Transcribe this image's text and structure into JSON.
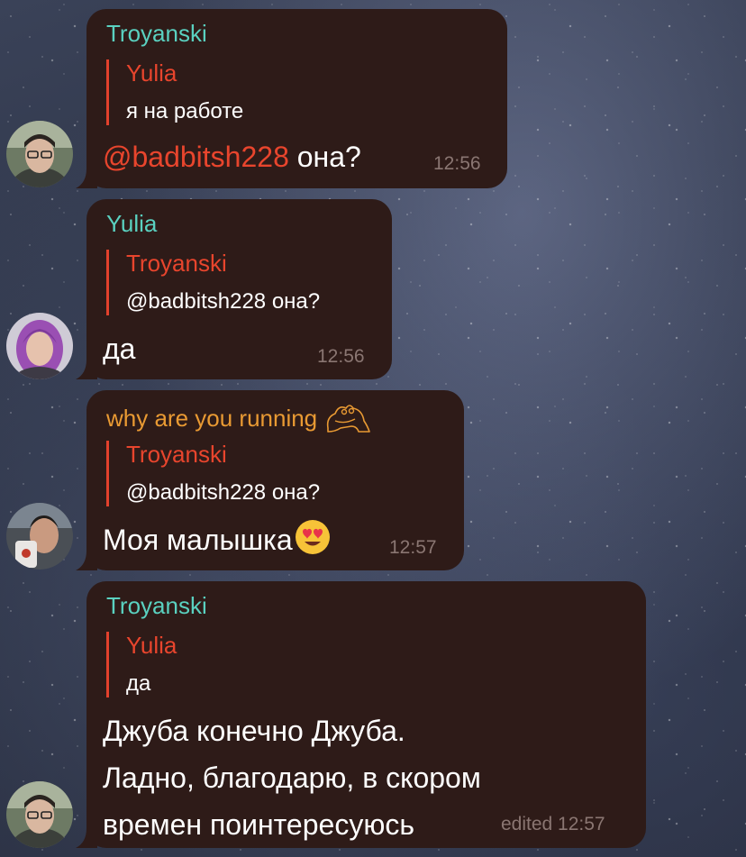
{
  "colors": {
    "bubble": "#2e1b18",
    "name_teal": "#5ad1c0",
    "name_orange": "#e99a33",
    "reply_accent": "#e3412c",
    "time": "#8a7672"
  },
  "messages": [
    {
      "sender": "Troyanski",
      "reply": {
        "name": "Yulia",
        "text": "я на работе"
      },
      "mention": "@badbitsh228",
      "text": " она?",
      "time": "12:56"
    },
    {
      "sender": "Yulia",
      "reply": {
        "name": "Troyanski",
        "text": "@badbitsh228 она?"
      },
      "text": "да",
      "time": "12:56"
    },
    {
      "sender": "why are you running",
      "sender_icon": "frog-sticker-icon",
      "reply": {
        "name": "Troyanski",
        "text": "@badbitsh228 она?"
      },
      "text": "Моя малышка",
      "emoji": "heart-eyes-emoji",
      "time": "12:57"
    },
    {
      "sender": "Troyanski",
      "reply": {
        "name": "Yulia",
        "text": "да"
      },
      "lines": [
        "Джуба конечно Джуба.",
        "Ладно, благодарю, в скором",
        "времен поинтересуюсь"
      ],
      "time": "edited 12:57"
    }
  ]
}
